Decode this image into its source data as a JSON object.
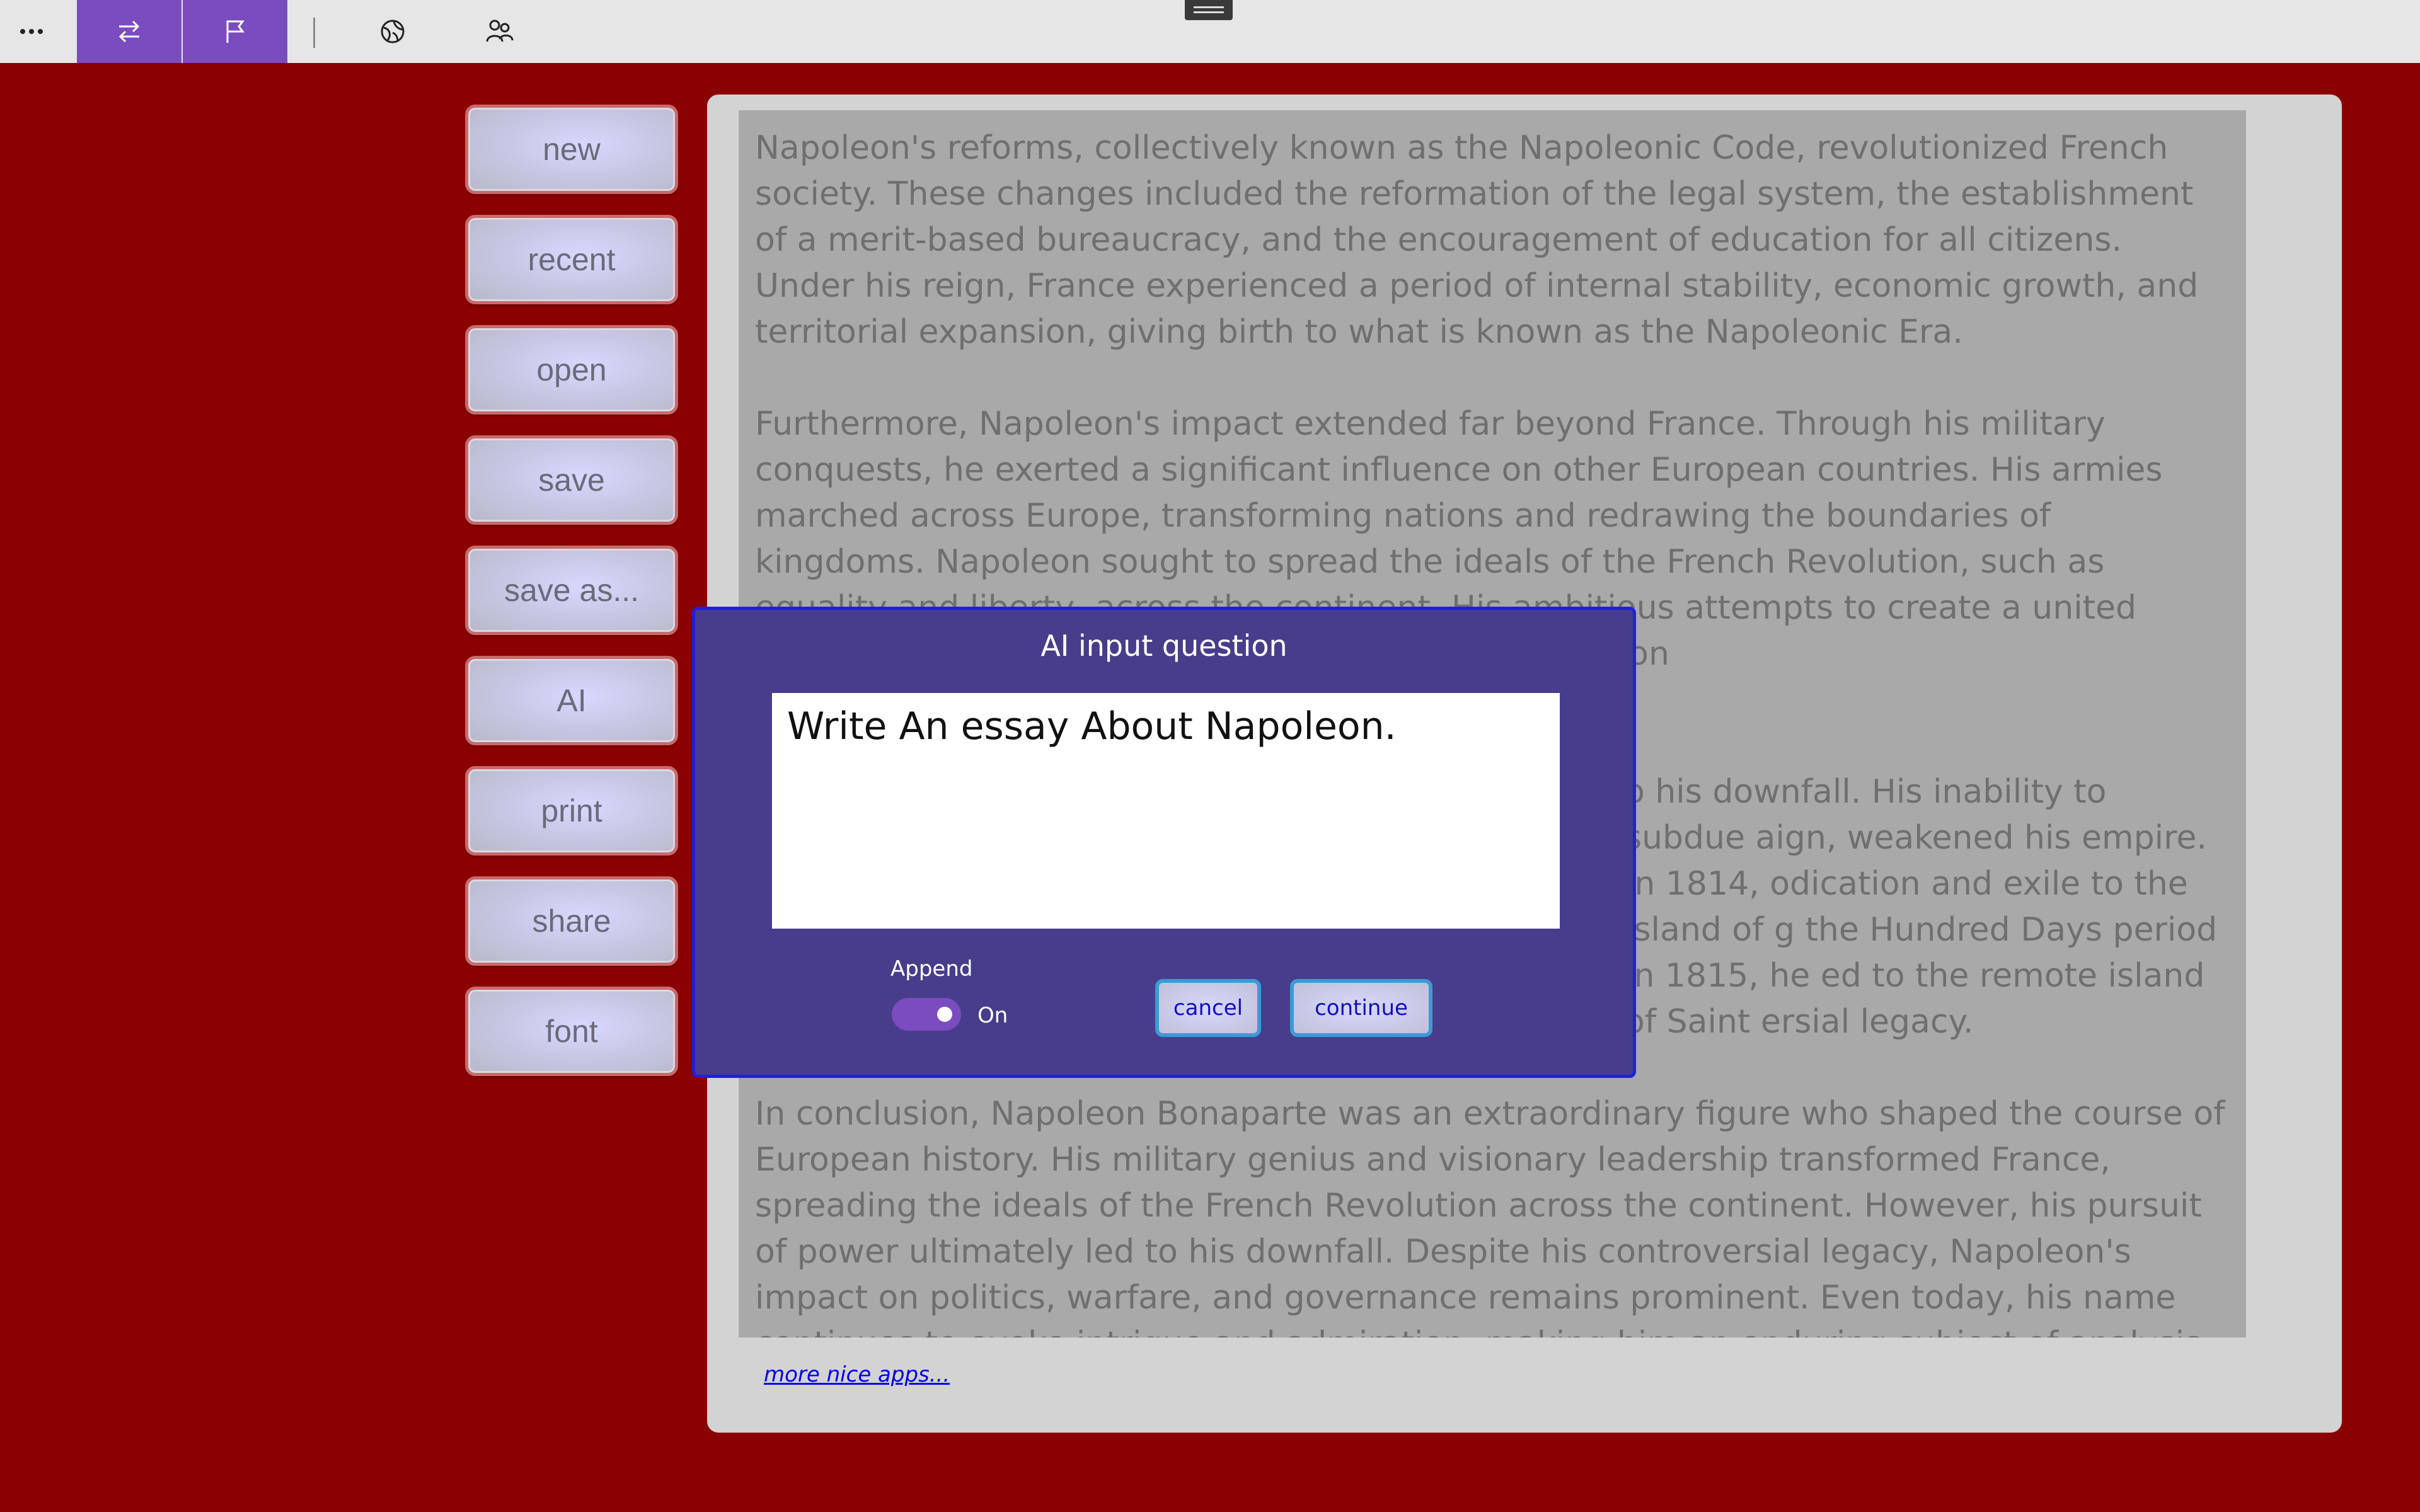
{
  "toolbar": {
    "more_icon": "more-horizontal-icon",
    "buttons": [
      {
        "name": "swap-icon",
        "active": true
      },
      {
        "name": "flag-icon",
        "active": true
      },
      {
        "name": "globe-icon",
        "active": false
      },
      {
        "name": "people-icon",
        "active": false
      }
    ]
  },
  "menu": {
    "new": "new",
    "recent": "recent",
    "open": "open",
    "save": "save",
    "save_as": "save as...",
    "ai": "AI",
    "print": "print",
    "share": "share",
    "font": "font"
  },
  "document": {
    "paragraphs": [
      "Napoleon's reforms, collectively known as the Napoleonic Code, revolutionized French society. These changes included the reformation of the legal system, the establishment of a merit-based bureaucracy, and the encouragement of education for all citizens. Under his reign, France experienced a period of internal stability, economic growth, and territorial expansion, giving birth to what is known as the Napoleonic Era.",
      "Furthermore, Napoleon's impact extended far beyond France. Through his military conquests, he exerted a significant influence on other European countries. His armies marched across Europe, transforming nations and redrawing the boundaries of kingdoms. Napoleon sought to spread the ideals of the French Revolution, such as equality and liberty, across the continent. His ambitious attempts to create a united Europe under French dominion left an indelible mark on",
      "o his downfall. His inability to subdue aign, weakened his empire. In 1814, odication and exile to the island of g the Hundred Days period in 1815, he ed to the remote island of Saint ersial legacy.",
      "In conclusion, Napoleon Bonaparte was an extraordinary figure who shaped the course of European history. His military genius and visionary leadership transformed France, spreading the ideals of the French Revolution across the continent. However, his pursuit of power ultimately led to his downfall. Despite his controversial legacy, Napoleon's impact on politics, warfare, and governance remains prominent. Even today, his name continues to evoke intrigue and admiration, making him an enduring subject of analysis and study."
    ],
    "footer_link": "more nice apps..."
  },
  "dialog": {
    "title": "AI input question",
    "prompt_value": "Write An essay About Napoleon.",
    "append_label": "Append",
    "append_state": "On",
    "cancel_label": "cancel",
    "continue_label": "continue"
  },
  "colors": {
    "background": "#8b0000",
    "accent": "#7a4cbf",
    "dialog_bg": "#483d8b"
  }
}
